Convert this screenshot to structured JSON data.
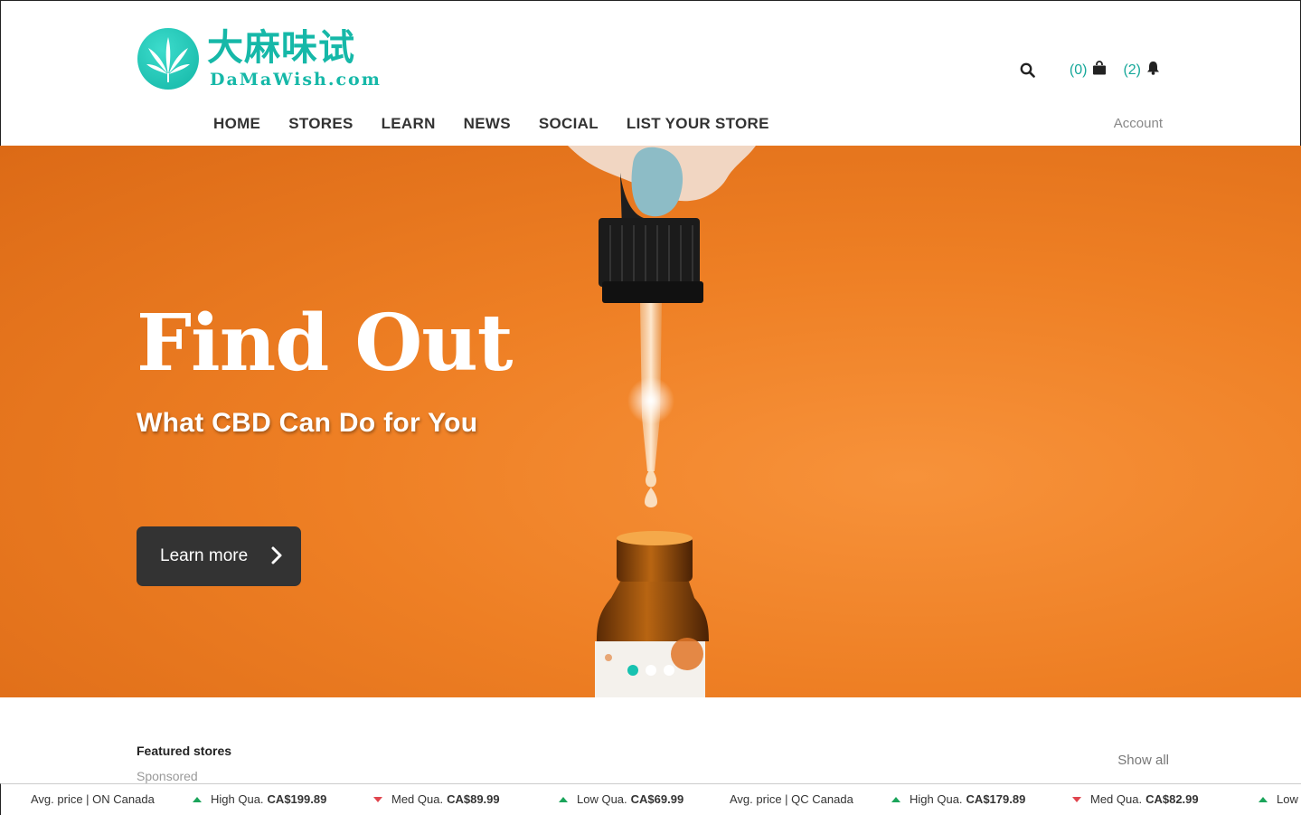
{
  "brand": {
    "name_cn": "大麻味试",
    "name_en": "DaMaWish.com",
    "accent_color": "#16b8a8",
    "logo_icon": "cannabis-leaf-icon"
  },
  "header": {
    "search_icon": "search-icon",
    "cart_count": "(0)",
    "cart_icon": "shopping-bag-icon",
    "notifications_count": "(2)",
    "notifications_icon": "bell-icon",
    "account_label": "Account"
  },
  "nav": {
    "items": [
      {
        "label": "HOME"
      },
      {
        "label": "STORES"
      },
      {
        "label": "LEARN"
      },
      {
        "label": "NEWS"
      },
      {
        "label": "SOCIAL"
      },
      {
        "label": "LIST YOUR STORE"
      }
    ]
  },
  "hero": {
    "title": "Find Out",
    "subtitle": "What CBD Can Do for You",
    "button_label": "Learn more",
    "background_color": "#ee7f24",
    "slides_total": 3,
    "active_slide": 1
  },
  "featured": {
    "heading": "Featured stores",
    "subheading": "Sponsored",
    "show_all_label": "Show all"
  },
  "ticker": {
    "items": [
      {
        "type": "label",
        "text": "Avg. price | ON Canada"
      },
      {
        "type": "price",
        "direction": "up",
        "label": "High Qua.",
        "value": "CA$199.89"
      },
      {
        "type": "price",
        "direction": "down",
        "label": "Med Qua.",
        "value": "CA$89.99"
      },
      {
        "type": "price",
        "direction": "up",
        "label": "Low Qua.",
        "value": "CA$69.99"
      },
      {
        "type": "label",
        "text": "Avg. price | QC Canada"
      },
      {
        "type": "price",
        "direction": "up",
        "label": "High Qua.",
        "value": "CA$179.89"
      },
      {
        "type": "price",
        "direction": "down",
        "label": "Med Qua.",
        "value": "CA$82.99"
      },
      {
        "type": "price",
        "direction": "up",
        "label": "Low Q",
        "value": ""
      }
    ]
  }
}
